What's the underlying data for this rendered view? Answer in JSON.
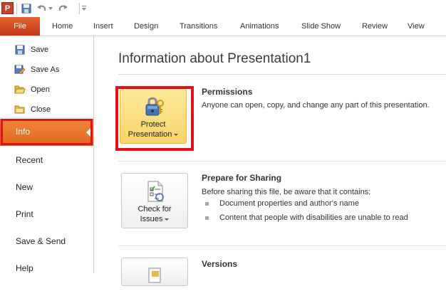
{
  "quick_access": {
    "app_letter": "P",
    "icons": [
      "powerpoint-app-icon",
      "save-icon",
      "undo-icon",
      "undo-dropdown-icon",
      "redo-icon",
      "customize-toolbar-icon"
    ]
  },
  "ribbon": {
    "file_tab": "File",
    "tabs": [
      "Home",
      "Insert",
      "Design",
      "Transitions",
      "Animations",
      "Slide Show",
      "Review",
      "View"
    ]
  },
  "backstage_nav": {
    "commands": [
      {
        "label": "Save",
        "icon": "save-icon"
      },
      {
        "label": "Save As",
        "icon": "save-as-icon"
      },
      {
        "label": "Open",
        "icon": "open-folder-icon"
      },
      {
        "label": "Close",
        "icon": "close-document-icon"
      }
    ],
    "selected": "Info",
    "items": [
      "Recent",
      "New",
      "Print",
      "Save & Send",
      "Help"
    ]
  },
  "info": {
    "title": "Information about Presentation1",
    "permissions": {
      "heading": "Permissions",
      "text": "Anyone can open, copy, and change any part of this presentation.",
      "button_line1": "Protect",
      "button_line2": "Presentation"
    },
    "prepare": {
      "heading": "Prepare for Sharing",
      "text": "Before sharing this file, be aware that it contains:",
      "bullets": [
        "Document properties and author's name",
        "Content that people with disabilities are unable to read"
      ],
      "button_line1": "Check for",
      "button_line2": "Issues"
    },
    "versions": {
      "heading": "Versions"
    }
  },
  "colors": {
    "file_tab": "#d1421f",
    "info_selected": "#ea7425",
    "highlight_box": "#e4111b",
    "protect_button": "#f8d468"
  }
}
